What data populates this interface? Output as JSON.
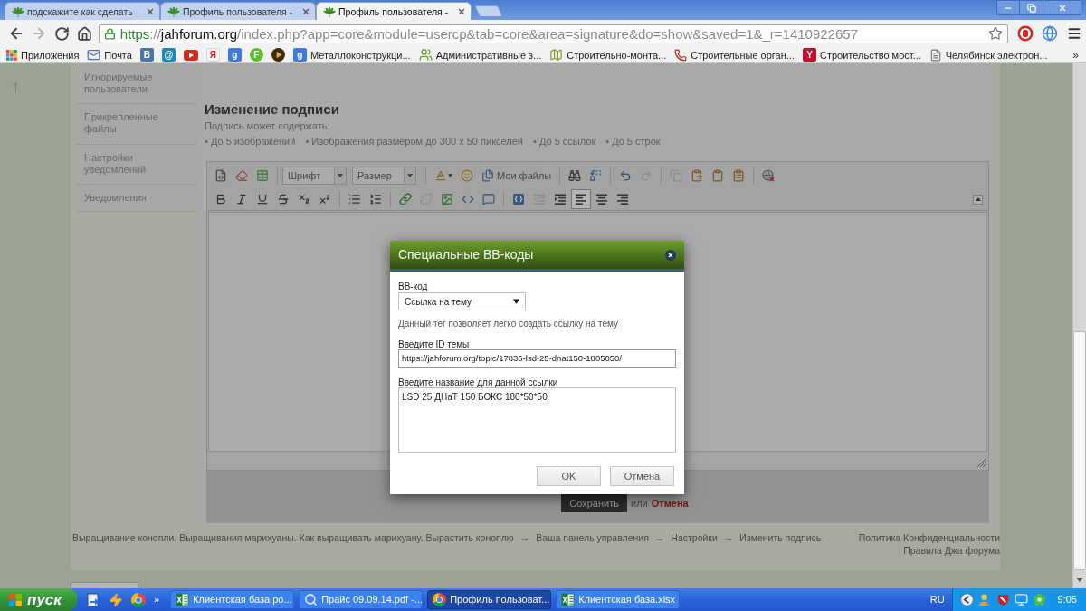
{
  "browser": {
    "tabs": [
      {
        "title": "подскажите как сделать",
        "selected": false
      },
      {
        "title": "Профиль пользователя -",
        "selected": false
      },
      {
        "title": "Профиль пользователя -",
        "selected": true
      }
    ],
    "navigation": [
      {
        "kind": "back",
        "disabled": false
      },
      {
        "kind": "forward",
        "disabled": true
      },
      {
        "kind": "reload",
        "disabled": false
      },
      {
        "kind": "home",
        "disabled": false
      }
    ],
    "address": [
      {
        "text": "https",
        "kind": "scheme"
      },
      {
        "text": "://",
        "kind": "dim"
      },
      {
        "text": "jahforum.org",
        "kind": "host"
      },
      {
        "text": "/index.php?app=core&module=usercp&tab=core&area=signature&do=show&saved=1&_r=1410922657",
        "kind": "dim"
      }
    ],
    "bookmarks": [
      {
        "kind": "apps",
        "label": "Приложения"
      },
      {
        "kind": "mail",
        "label": "Почта"
      },
      {
        "kind": "tile",
        "glyph": "B",
        "color": "#4a76a8"
      },
      {
        "kind": "tile",
        "glyph": "@",
        "color": "#1e88c7"
      },
      {
        "kind": "youtube"
      },
      {
        "kind": "letter",
        "glyph": "Я",
        "color": "#e02020"
      },
      {
        "kind": "tile",
        "glyph": "g",
        "color": "#3b7be0"
      },
      {
        "kind": "disc",
        "glyph": "F",
        "color": "#5bbf2a"
      },
      {
        "kind": "player"
      },
      {
        "kind": "tile",
        "glyph": "g",
        "color": "#3b7be0",
        "label": "Металлоконструкци..."
      },
      {
        "kind": "people",
        "label": "Административные з..."
      },
      {
        "kind": "map",
        "label": "Строительно-монта..."
      },
      {
        "kind": "phone",
        "label": "Строительные орган..."
      },
      {
        "kind": "tile",
        "glyph": "Y",
        "color": "#c8102e",
        "label": "Строительство мост..."
      },
      {
        "kind": "page",
        "label": "Челябинск электрон..."
      }
    ],
    "bookmarks_overflow": "»"
  },
  "page": {
    "scroll_top": "↑",
    "sidebar": [
      {
        "label": "Игнорируемые пользователи"
      },
      {
        "label": "Прикрепленные файлы"
      },
      {
        "label": "Настройки уведомлений"
      },
      {
        "label": "Уведомления"
      }
    ],
    "signature": {
      "title": "Изменение подписи",
      "intro": "Подпись может содержать:",
      "limits": [
        "• До 5 изображений",
        "• Изображения размером до 300 x 50 пикселей",
        "• До 5 ссылок",
        "• До 5 строк"
      ]
    },
    "editor": {
      "toolbar": [
        [
          [
            {
              "kind": "source",
              "disabled": false,
              "pressed": false
            },
            {
              "kind": "eraser",
              "disabled": false,
              "pressed": false
            },
            {
              "kind": "template",
              "disabled": false,
              "pressed": false
            }
          ],
          [
            {
              "kind": "select",
              "label": "Шрифт",
              "disabled": false,
              "pressed": false
            },
            {
              "kind": "select",
              "label": "Размер",
              "disabled": false,
              "pressed": false
            }
          ],
          [
            {
              "kind": "color",
              "disabled": false,
              "pressed": false
            },
            {
              "kind": "emoji",
              "disabled": false,
              "pressed": false
            },
            {
              "kind": "files",
              "label": "Мои файлы",
              "disabled": false,
              "pressed": false
            }
          ],
          [
            {
              "kind": "find",
              "disabled": false,
              "pressed": false
            },
            {
              "kind": "replace",
              "disabled": false,
              "pressed": false
            }
          ],
          [
            {
              "kind": "undo",
              "disabled": false,
              "pressed": false
            },
            {
              "kind": "redo",
              "disabled": true,
              "pressed": false
            }
          ],
          [
            {
              "kind": "copy",
              "disabled": true,
              "pressed": false
            },
            {
              "kind": "paste",
              "disabled": false,
              "pressed": false
            },
            {
              "kind": "pastetext",
              "disabled": false,
              "pressed": false
            },
            {
              "kind": "pasteword",
              "disabled": false,
              "pressed": false
            }
          ],
          [
            {
              "kind": "spell",
              "disabled": false,
              "pressed": false
            }
          ]
        ],
        [
          [
            {
              "kind": "bold",
              "disabled": false,
              "pressed": false
            },
            {
              "kind": "italic",
              "disabled": false,
              "pressed": false
            },
            {
              "kind": "underline",
              "disabled": false,
              "pressed": false
            },
            {
              "kind": "strike",
              "disabled": false,
              "pressed": false
            },
            {
              "kind": "sub",
              "disabled": false,
              "pressed": false
            },
            {
              "kind": "sup",
              "disabled": false,
              "pressed": false
            }
          ],
          [
            {
              "kind": "bullets",
              "disabled": false,
              "pressed": false
            },
            {
              "kind": "numbers",
              "disabled": false,
              "pressed": false
            }
          ],
          [
            {
              "kind": "link",
              "disabled": false,
              "pressed": false
            },
            {
              "kind": "unlink",
              "disabled": true,
              "pressed": false
            },
            {
              "kind": "image",
              "disabled": false,
              "pressed": false
            },
            {
              "kind": "code",
              "disabled": false,
              "pressed": false
            },
            {
              "kind": "quote",
              "disabled": false,
              "pressed": false
            }
          ],
          [
            {
              "kind": "bbcode",
              "disabled": false,
              "pressed": false
            },
            {
              "kind": "outdent",
              "disabled": true,
              "pressed": false
            },
            {
              "kind": "indent",
              "disabled": false,
              "pressed": false
            },
            {
              "kind": "alignleft",
              "disabled": false,
              "pressed": true
            },
            {
              "kind": "aligncenter",
              "disabled": false,
              "pressed": false
            },
            {
              "kind": "alignright",
              "disabled": false,
              "pressed": false
            }
          ]
        ]
      ]
    },
    "form": {
      "save": "Сохранить",
      "or": "или",
      "cancel": "Отмена"
    },
    "footer": {
      "breadcrumbs": [
        "Выращивание конопли. Выращивания марихуаны. Как выращивать марихуану. Вырастить коноплю",
        "Ваша панель управления",
        "Настройки",
        "Изменить подпись"
      ],
      "separator": "→",
      "links": [
        "Политика Конфиденциальности",
        "Правила Джа форума"
      ]
    }
  },
  "dialog": {
    "title": "Специальные BB-коды",
    "fields": [
      {
        "kind": "select",
        "label": "BB-код",
        "value": "Ссылка на тему"
      },
      {
        "kind": "note",
        "text": "Данный тег позволяет легко создать ссылку на тему"
      },
      {
        "kind": "input",
        "label": "Введите ID темы",
        "value": "https://jahforum.org/topic/17836-lsd-25-dnat150-1805050/"
      },
      {
        "kind": "textarea",
        "label": "Введите название для данной ссылки",
        "value": "LSD 25 ДНаТ 150 БОКС 180*50*50"
      }
    ],
    "buttons": [
      "OK",
      "Отмена"
    ]
  },
  "taskbar": {
    "start": "пуск",
    "quick_overflow": "»",
    "tasks": [
      {
        "kind": "excel",
        "label": "Клиентская база ро...",
        "selected": false
      },
      {
        "kind": "pdf",
        "label": "Прайс 09.09.14.pdf -...",
        "selected": false
      },
      {
        "kind": "browser",
        "label": "Профиль пользоват...",
        "selected": true
      },
      {
        "kind": "excel",
        "label": "Клиентская база.xlsx",
        "selected": false
      }
    ],
    "language": "RU",
    "clock": "9:05"
  }
}
